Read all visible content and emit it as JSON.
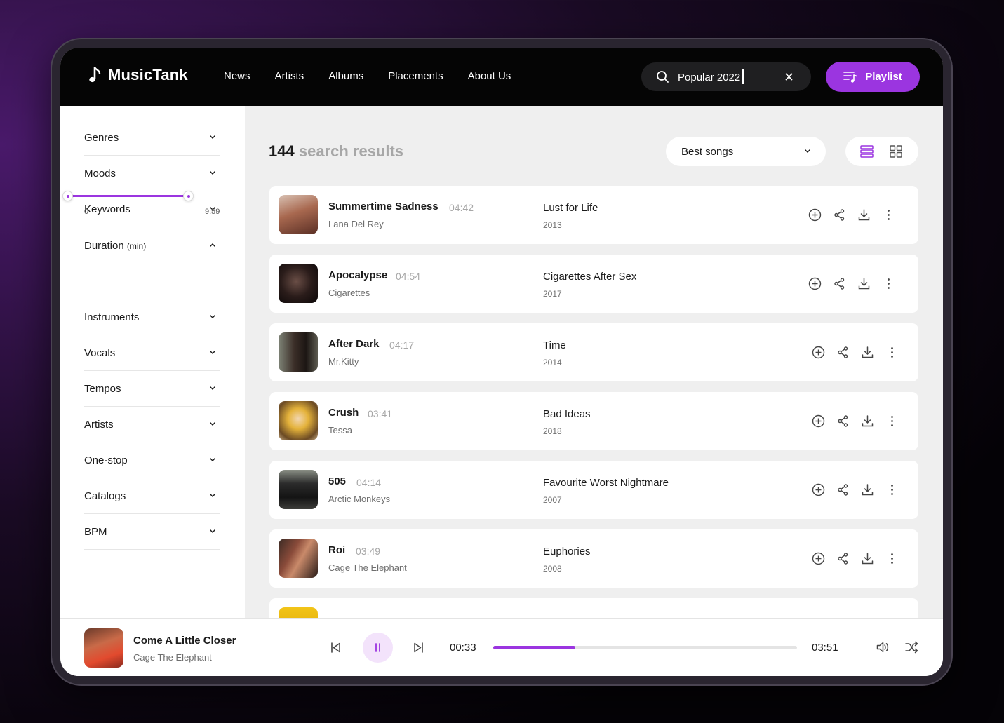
{
  "brand": {
    "name": "MusicTank",
    "accent": "#9b35e0"
  },
  "nav": [
    {
      "label": "News"
    },
    {
      "label": "Artists"
    },
    {
      "label": "Albums"
    },
    {
      "label": "Placements"
    },
    {
      "label": "About Us"
    }
  ],
  "search": {
    "value": "Popular 2022"
  },
  "playlist_button": {
    "label": "Playlist"
  },
  "filters": {
    "genres": "Genres",
    "moods": "Moods",
    "keywords": "Keywords",
    "duration": "Duration",
    "duration_unit": "(min)",
    "duration_min": "0",
    "duration_max": "9:59",
    "instruments": "Instruments",
    "vocals": "Vocals",
    "tempos": "Tempos",
    "artists": "Artists",
    "one_stop": "One-stop",
    "catalogs": "Catalogs",
    "bpm": "BPM"
  },
  "results": {
    "count": "144",
    "label": "search results"
  },
  "sort": {
    "selected": "Best songs"
  },
  "songs": [
    {
      "title": "Summertime Sadness",
      "duration": "04:42",
      "artist": "Lana Del Rey",
      "album": "Lust for Life",
      "year": "2013"
    },
    {
      "title": "Apocalypse",
      "duration": "04:54",
      "artist": "Cigarettes",
      "album": "Cigarettes After Sex",
      "year": "2017"
    },
    {
      "title": "After Dark",
      "duration": "04:17",
      "artist": "Mr.Kitty",
      "album": "Time",
      "year": "2014"
    },
    {
      "title": "Crush",
      "duration": "03:41",
      "artist": "Tessa",
      "album": "Bad Ideas",
      "year": "2018"
    },
    {
      "title": "505",
      "duration": "04:14",
      "artist": "Arctic Monkeys",
      "album": "Favourite Worst Nightmare",
      "year": "2007"
    },
    {
      "title": "Roi",
      "duration": "03:49",
      "artist": "Cage The Elephant",
      "album": "Euphories",
      "year": "2008"
    }
  ],
  "player": {
    "title": "Come A Little Closer",
    "artist": "Cage The Elephant",
    "current_time": "00:33",
    "total_time": "03:51",
    "progress": 0.27
  }
}
